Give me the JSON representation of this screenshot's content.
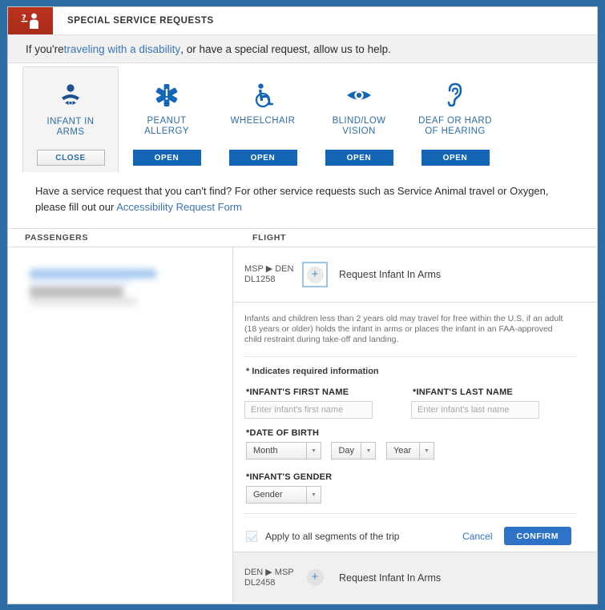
{
  "window": {
    "frame_color": "#2E6DA4"
  },
  "header": {
    "icon": "person-question-icon",
    "title": "SPECIAL SERVICE REQUESTS"
  },
  "intro": {
    "prefix": "If you're ",
    "link": "traveling with a disability",
    "suffix": " , or have a special request, allow us to help."
  },
  "services": [
    {
      "icon": "infant-icon",
      "label": "INFANT IN\nARMS",
      "button": "CLOSE",
      "state": "open",
      "selected": true
    },
    {
      "icon": "star-of-life-icon",
      "label": "PEANUT\nALLERGY",
      "button": "OPEN",
      "state": "closed",
      "selected": false
    },
    {
      "icon": "wheelchair-icon",
      "label": "WHEELCHAIR",
      "button": "OPEN",
      "state": "closed",
      "selected": false
    },
    {
      "icon": "eye-icon",
      "label": "BLIND/LOW\nVISION",
      "button": "OPEN",
      "state": "closed",
      "selected": false
    },
    {
      "icon": "ear-icon",
      "label": "DEAF OR HARD\nOF HEARING",
      "button": "OPEN",
      "state": "closed",
      "selected": false
    }
  ],
  "access_note": {
    "text": "Have a service request that you can't find? For other service requests such as Service Animal travel or Oxygen, please fill out our ",
    "link": "Accessibility Request Form"
  },
  "columns": {
    "passengers": "PASSENGERS",
    "flight": "FLIGHT"
  },
  "flights": [
    {
      "route": "MSP ▶ DEN",
      "number": "DL1258",
      "action": "Request Infant In Arms",
      "expanded": true
    },
    {
      "route": "DEN ▶ MSP",
      "number": "DL2458",
      "action": "Request Infant In Arms",
      "expanded": false
    }
  ],
  "form": {
    "info": "Infants and children less than 2 years old may travel for free within the U.S. if an adult (18 years or older) holds the infant in arms or places the infant in an FAA-approved child restraint during take-off and landing.",
    "required_note": "* Indicates required information",
    "first_name": {
      "label": "*INFANT'S FIRST NAME",
      "placeholder": "Enter infant's first name",
      "value": ""
    },
    "last_name": {
      "label": "*INFANT'S LAST NAME",
      "placeholder": "Enter infant's last name",
      "value": ""
    },
    "dob": {
      "label": "*DATE OF BIRTH",
      "month": "Month",
      "day": "Day",
      "year": "Year"
    },
    "gender": {
      "label": "*INFANT'S GENDER",
      "value": "Gender"
    },
    "apply_all": {
      "label": "Apply to all segments of the trip",
      "checked": true
    },
    "cancel": "Cancel",
    "confirm": "CONFIRM"
  }
}
